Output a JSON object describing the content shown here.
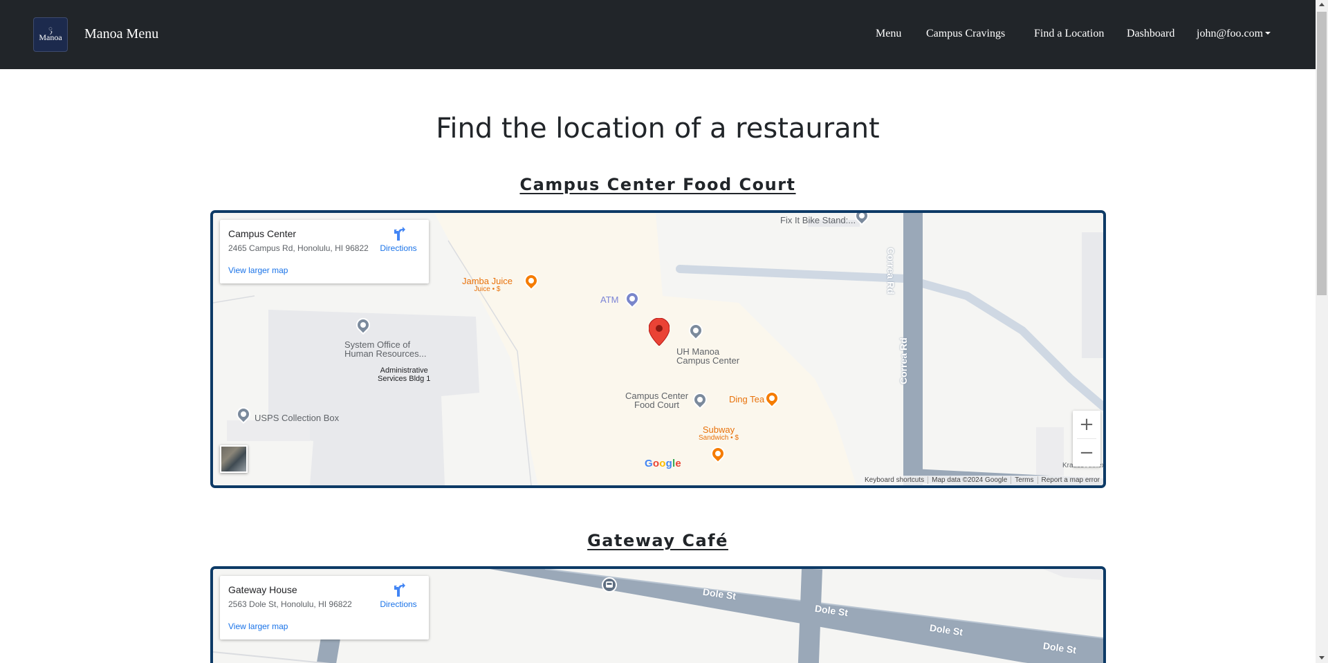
{
  "navbar": {
    "logo_crest": "ꪴ",
    "logo_text": "Manoa",
    "brand": "Manoa Menu",
    "links": {
      "menu": "Menu",
      "campus_cravings": "Campus Cravings",
      "find_location": "Find a Location",
      "dashboard": "Dashboard",
      "user": "john@foo.com"
    }
  },
  "page": {
    "title": "Find the location of a restaurant"
  },
  "sections": [
    {
      "title": "Campus Center Food Court",
      "map": {
        "place_name": "Campus Center",
        "address": "2465 Campus Rd, Honolulu, HI 96822",
        "directions": "Directions",
        "larger_map": "View larger map",
        "labels": {
          "fix_it": "Fix It Bike Stand:...",
          "jamba": "Jamba Juice",
          "jamba_sub": "Juice • $",
          "atm": "ATM",
          "system_office_1": "System Office of",
          "system_office_2": "Human Resources...",
          "admin_1": "Administrative",
          "admin_2": "Services Bldg 1",
          "uh_manoa_1": "UH Manoa",
          "uh_manoa_2": "Campus Center",
          "food_court_1": "Campus Center",
          "food_court_2": "Food Court",
          "ding_tea": "Ding Tea",
          "subway": "Subway",
          "subway_sub": "Sandwich • $",
          "usps": "USPS Collection Box",
          "correa_1": "Correa Rd",
          "correa_2": "Correa Rd",
          "krauss": "Krauss Annex"
        },
        "google": "Google",
        "attribution": {
          "shortcuts": "Keyboard shortcuts",
          "map_data": "Map data ©2024 Google",
          "terms": "Terms",
          "report": "Report a map error"
        },
        "zoom_in": "+",
        "zoom_out": "−"
      }
    },
    {
      "title": "Gateway Café",
      "map": {
        "place_name": "Gateway House",
        "address": "2563 Dole St, Honolulu, HI 96822",
        "directions": "Directions",
        "larger_map": "View larger map",
        "labels": {
          "dole_1": "Dole St",
          "dole_2": "Dole St",
          "dole_3": "Dole St",
          "dole_4": "Dole St"
        }
      }
    }
  ]
}
